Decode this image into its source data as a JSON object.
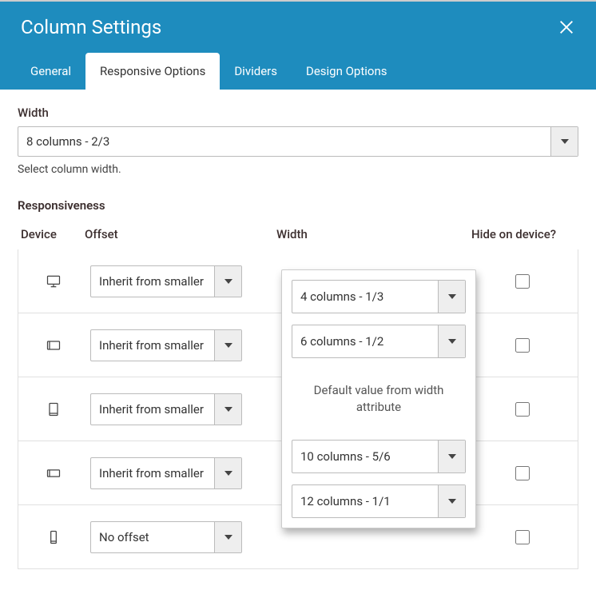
{
  "dialog": {
    "title": "Column Settings"
  },
  "tabs": [
    {
      "label": "General"
    },
    {
      "label": "Responsive Options",
      "active": true
    },
    {
      "label": "Dividers"
    },
    {
      "label": "Design Options"
    }
  ],
  "width_field": {
    "label": "Width",
    "value": "8 columns - 2/3",
    "help": "Select column width."
  },
  "responsiveness": {
    "title": "Responsiveness",
    "columns": {
      "device": "Device",
      "offset": "Offset",
      "width": "Width",
      "hide": "Hide on device?"
    },
    "rows": [
      {
        "device": "desktop",
        "offset": "Inherit from smaller",
        "hide": false
      },
      {
        "device": "tablet-landscape",
        "offset": "Inherit from smaller",
        "hide": false
      },
      {
        "device": "tablet-portrait",
        "offset": "Inherit from smaller",
        "hide": false
      },
      {
        "device": "phone-landscape",
        "offset": "Inherit from smaller",
        "hide": false
      },
      {
        "device": "phone-portrait",
        "offset": "No offset",
        "hide": false
      }
    ]
  },
  "width_overlay": {
    "options": [
      "4 columns - 1/3",
      "6 columns - 1/2",
      null,
      "10 columns - 5/6",
      "12 columns - 1/1"
    ],
    "default_text": "Default value from width attribute"
  }
}
